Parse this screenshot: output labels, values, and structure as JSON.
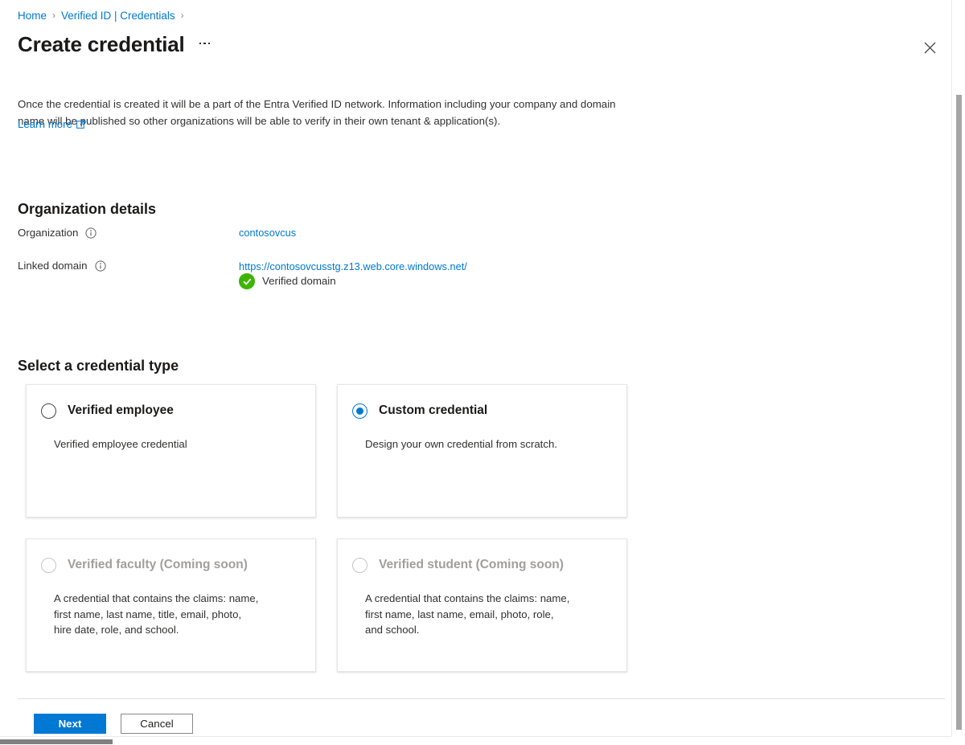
{
  "breadcrumb": {
    "items": [
      {
        "label": "Home",
        "icon": "chevron-right-icon"
      },
      {
        "label": "Verified ID | Credentials",
        "icon": "chevron-right-icon"
      }
    ],
    "separator": "›"
  },
  "header": {
    "title": "Create credential",
    "more_menu_label": "…",
    "close_label": "✕"
  },
  "intro": {
    "text": "Once the credential is created it will be a part of the Entra Verified ID network. Information including your company and domain name will be published so other organizations will be able to verify in their own tenant & application(s).",
    "learn_more_label": "Learn more",
    "learn_more_icon": "external-link-icon"
  },
  "organization_details": {
    "heading": "Organization details",
    "fields": [
      {
        "label": "Organization",
        "info_icon": "info-circle-icon",
        "value": "contosovcus"
      },
      {
        "label": "Linked domain",
        "info_icon": "info-circle-icon",
        "value": "https://contosovcusstg.z13.web.core.windows.net/",
        "status_icon": "check-circle-icon",
        "status_text": "Verified domain"
      }
    ]
  },
  "credential_type": {
    "heading": "Select a credential type",
    "cards": [
      {
        "title": "Verified employee",
        "description": "Verified employee credential",
        "selected": false,
        "disabled": false,
        "radio_icon": "radio-unchecked-icon"
      },
      {
        "title": "Custom credential",
        "description": "Design your own credential from scratch.",
        "selected": true,
        "disabled": false,
        "radio_icon": "radio-checked-icon"
      },
      {
        "title": "Verified faculty (Coming soon)",
        "description": "A credential that contains the claims: name,\nfirst name, last name, title, email, photo,\nhire date, role, and school.",
        "selected": false,
        "disabled": true,
        "radio_icon": "radio-unchecked-icon"
      },
      {
        "title": "Verified student (Coming soon)",
        "description": "A credential that contains the claims: name,\nfirst name, last name, email, photo, role,\nand school.",
        "selected": false,
        "disabled": true,
        "radio_icon": "radio-unchecked-icon"
      }
    ]
  },
  "footer": {
    "next_label": "Next",
    "cancel_label": "Cancel"
  },
  "colors": {
    "accent": "#0078d4",
    "link": "#0078d4",
    "verified_green": "#3db500",
    "text": "#323130",
    "disabled_text": "#a19f9d",
    "card_border": "#e6e6e6"
  }
}
